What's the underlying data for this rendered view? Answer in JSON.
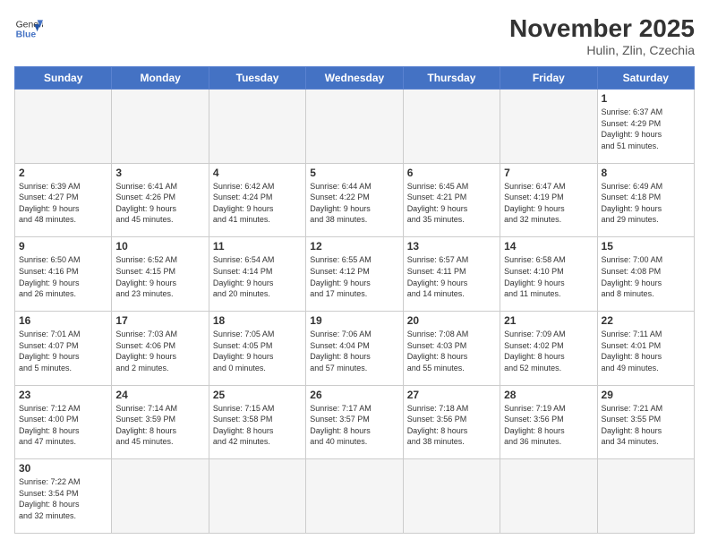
{
  "header": {
    "logo_general": "General",
    "logo_blue": "Blue",
    "month_year": "November 2025",
    "location": "Hulin, Zlin, Czechia"
  },
  "weekdays": [
    "Sunday",
    "Monday",
    "Tuesday",
    "Wednesday",
    "Thursday",
    "Friday",
    "Saturday"
  ],
  "weeks": [
    [
      {
        "day": "",
        "info": ""
      },
      {
        "day": "",
        "info": ""
      },
      {
        "day": "",
        "info": ""
      },
      {
        "day": "",
        "info": ""
      },
      {
        "day": "",
        "info": ""
      },
      {
        "day": "",
        "info": ""
      },
      {
        "day": "1",
        "info": "Sunrise: 6:37 AM\nSunset: 4:29 PM\nDaylight: 9 hours\nand 51 minutes."
      }
    ],
    [
      {
        "day": "2",
        "info": "Sunrise: 6:39 AM\nSunset: 4:27 PM\nDaylight: 9 hours\nand 48 minutes."
      },
      {
        "day": "3",
        "info": "Sunrise: 6:41 AM\nSunset: 4:26 PM\nDaylight: 9 hours\nand 45 minutes."
      },
      {
        "day": "4",
        "info": "Sunrise: 6:42 AM\nSunset: 4:24 PM\nDaylight: 9 hours\nand 41 minutes."
      },
      {
        "day": "5",
        "info": "Sunrise: 6:44 AM\nSunset: 4:22 PM\nDaylight: 9 hours\nand 38 minutes."
      },
      {
        "day": "6",
        "info": "Sunrise: 6:45 AM\nSunset: 4:21 PM\nDaylight: 9 hours\nand 35 minutes."
      },
      {
        "day": "7",
        "info": "Sunrise: 6:47 AM\nSunset: 4:19 PM\nDaylight: 9 hours\nand 32 minutes."
      },
      {
        "day": "8",
        "info": "Sunrise: 6:49 AM\nSunset: 4:18 PM\nDaylight: 9 hours\nand 29 minutes."
      }
    ],
    [
      {
        "day": "9",
        "info": "Sunrise: 6:50 AM\nSunset: 4:16 PM\nDaylight: 9 hours\nand 26 minutes."
      },
      {
        "day": "10",
        "info": "Sunrise: 6:52 AM\nSunset: 4:15 PM\nDaylight: 9 hours\nand 23 minutes."
      },
      {
        "day": "11",
        "info": "Sunrise: 6:54 AM\nSunset: 4:14 PM\nDaylight: 9 hours\nand 20 minutes."
      },
      {
        "day": "12",
        "info": "Sunrise: 6:55 AM\nSunset: 4:12 PM\nDaylight: 9 hours\nand 17 minutes."
      },
      {
        "day": "13",
        "info": "Sunrise: 6:57 AM\nSunset: 4:11 PM\nDaylight: 9 hours\nand 14 minutes."
      },
      {
        "day": "14",
        "info": "Sunrise: 6:58 AM\nSunset: 4:10 PM\nDaylight: 9 hours\nand 11 minutes."
      },
      {
        "day": "15",
        "info": "Sunrise: 7:00 AM\nSunset: 4:08 PM\nDaylight: 9 hours\nand 8 minutes."
      }
    ],
    [
      {
        "day": "16",
        "info": "Sunrise: 7:01 AM\nSunset: 4:07 PM\nDaylight: 9 hours\nand 5 minutes."
      },
      {
        "day": "17",
        "info": "Sunrise: 7:03 AM\nSunset: 4:06 PM\nDaylight: 9 hours\nand 2 minutes."
      },
      {
        "day": "18",
        "info": "Sunrise: 7:05 AM\nSunset: 4:05 PM\nDaylight: 9 hours\nand 0 minutes."
      },
      {
        "day": "19",
        "info": "Sunrise: 7:06 AM\nSunset: 4:04 PM\nDaylight: 8 hours\nand 57 minutes."
      },
      {
        "day": "20",
        "info": "Sunrise: 7:08 AM\nSunset: 4:03 PM\nDaylight: 8 hours\nand 55 minutes."
      },
      {
        "day": "21",
        "info": "Sunrise: 7:09 AM\nSunset: 4:02 PM\nDaylight: 8 hours\nand 52 minutes."
      },
      {
        "day": "22",
        "info": "Sunrise: 7:11 AM\nSunset: 4:01 PM\nDaylight: 8 hours\nand 49 minutes."
      }
    ],
    [
      {
        "day": "23",
        "info": "Sunrise: 7:12 AM\nSunset: 4:00 PM\nDaylight: 8 hours\nand 47 minutes."
      },
      {
        "day": "24",
        "info": "Sunrise: 7:14 AM\nSunset: 3:59 PM\nDaylight: 8 hours\nand 45 minutes."
      },
      {
        "day": "25",
        "info": "Sunrise: 7:15 AM\nSunset: 3:58 PM\nDaylight: 8 hours\nand 42 minutes."
      },
      {
        "day": "26",
        "info": "Sunrise: 7:17 AM\nSunset: 3:57 PM\nDaylight: 8 hours\nand 40 minutes."
      },
      {
        "day": "27",
        "info": "Sunrise: 7:18 AM\nSunset: 3:56 PM\nDaylight: 8 hours\nand 38 minutes."
      },
      {
        "day": "28",
        "info": "Sunrise: 7:19 AM\nSunset: 3:56 PM\nDaylight: 8 hours\nand 36 minutes."
      },
      {
        "day": "29",
        "info": "Sunrise: 7:21 AM\nSunset: 3:55 PM\nDaylight: 8 hours\nand 34 minutes."
      }
    ],
    [
      {
        "day": "30",
        "info": "Sunrise: 7:22 AM\nSunset: 3:54 PM\nDaylight: 8 hours\nand 32 minutes."
      },
      {
        "day": "",
        "info": ""
      },
      {
        "day": "",
        "info": ""
      },
      {
        "day": "",
        "info": ""
      },
      {
        "day": "",
        "info": ""
      },
      {
        "day": "",
        "info": ""
      },
      {
        "day": "",
        "info": ""
      }
    ]
  ]
}
